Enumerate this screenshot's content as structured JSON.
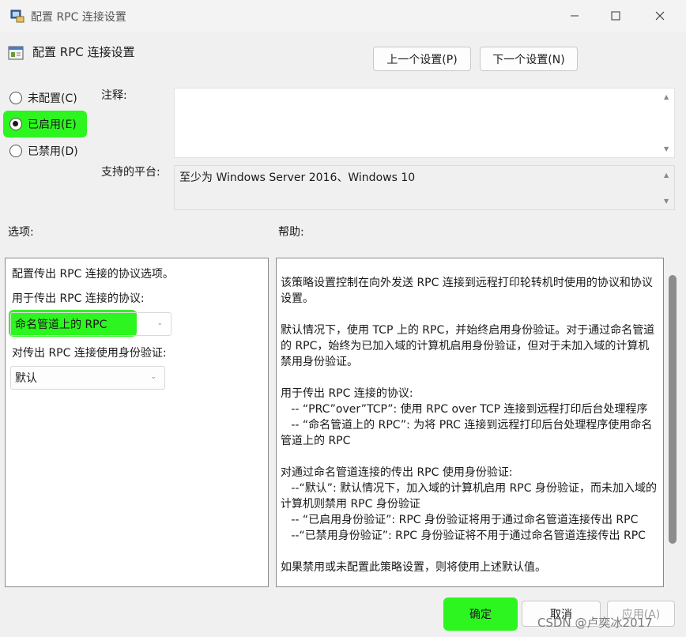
{
  "window": {
    "title": "配置 RPC 连接设置",
    "app_icon": "group-policy-icon",
    "controls": [
      "minimize-icon",
      "maximize-icon",
      "close-icon"
    ]
  },
  "header": {
    "title": "配置 RPC 连接设置",
    "prev_button": "上一个设置(P)",
    "next_button": "下一个设置(N)"
  },
  "state": {
    "options": [
      "未配置(C)",
      "已启用(E)",
      "已禁用(D)"
    ],
    "selected": "已启用(E)"
  },
  "comment": {
    "label": "注释:",
    "value": ""
  },
  "platform": {
    "label": "支持的平台:",
    "value": "至少为 Windows Server 2016、Windows 10"
  },
  "options_panel": {
    "label": "选项:",
    "intro": "配置传出 RPC 连接的协议选项。",
    "protocol_label": "用于传出 RPC 连接的协议:",
    "protocol_value": "命名管道上的 RPC",
    "auth_label": "对传出 RPC 连接使用身份验证:",
    "auth_value": "默认"
  },
  "help_panel": {
    "label": "帮助:",
    "text": "该策略设置控制在向外发送 RPC 连接到远程打印轮转机时使用的协议和协议设置。\n\n默认情况下，使用 TCP 上的 RPC，并始终启用身份验证。对于通过命名管道的 RPC，始终为已加入域的计算机启用身份验证，但对于未加入域的计算机禁用身份验证。\n\n用于传出 RPC 连接的协议:\n   -- “PRC”over”TCP”: 使用 RPC over TCP 连接到远程打印后台处理程序\n   -- “命名管道上的 RPC”: 为将 PRC 连接到远程打印后台处理程序使用命名管道上的 RPC\n\n对通过命名管道连接的传出 RPC 使用身份验证:\n   --“默认”: 默认情况下，加入域的计算机启用 RPC 身份验证，而未加入域的计算机则禁用 RPC 身份验证\n   -- “已启用身份验证”: RPC 身份验证将用于通过命名管道连接传出 RPC\n   --“已禁用身份验证”: RPC 身份验证将不用于通过命名管道连接传出 RPC\n\n如果禁用或未配置此策略设置，则将使用上述默认值。"
  },
  "footer": {
    "ok": "确定",
    "cancel": "取消",
    "apply": "应用(A)"
  },
  "watermark": "CSDN @卢奕冰2017",
  "colors": {
    "highlight": "#2df51f",
    "background": "#f0f0f0"
  }
}
